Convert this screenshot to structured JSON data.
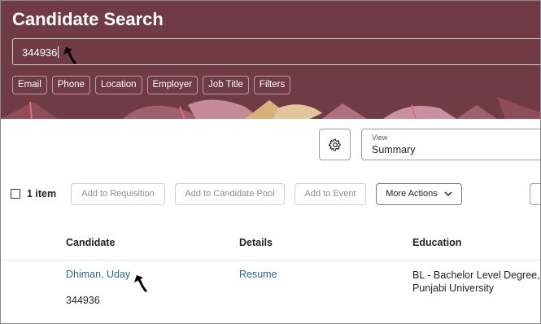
{
  "header": {
    "title": "Candidate Search",
    "search_value": "344936",
    "chips": [
      "Email",
      "Phone",
      "Location",
      "Employer",
      "Job Title",
      "Filters"
    ]
  },
  "view": {
    "label": "View",
    "value": "Summary"
  },
  "toolbar": {
    "item_count": "1 item",
    "add_to_requisition": "Add to Requisition",
    "add_to_candidate_pool": "Add to Candidate Pool",
    "add_to_event": "Add to Event",
    "more_actions": "More Actions"
  },
  "table": {
    "columns": [
      "Candidate",
      "Details",
      "Education"
    ],
    "rows": [
      {
        "name": "Dhiman, Uday",
        "id": "344936",
        "details_link": "Resume",
        "education_line1": "BL - Bachelor Level Degree,",
        "education_line2": "Punjabi University"
      }
    ]
  },
  "colors": {
    "header_bg": "#6f3b44",
    "link": "#2a6a8a"
  },
  "icons": [
    "gear-icon",
    "chevron-down-icon",
    "pointer-arrow-icon"
  ]
}
